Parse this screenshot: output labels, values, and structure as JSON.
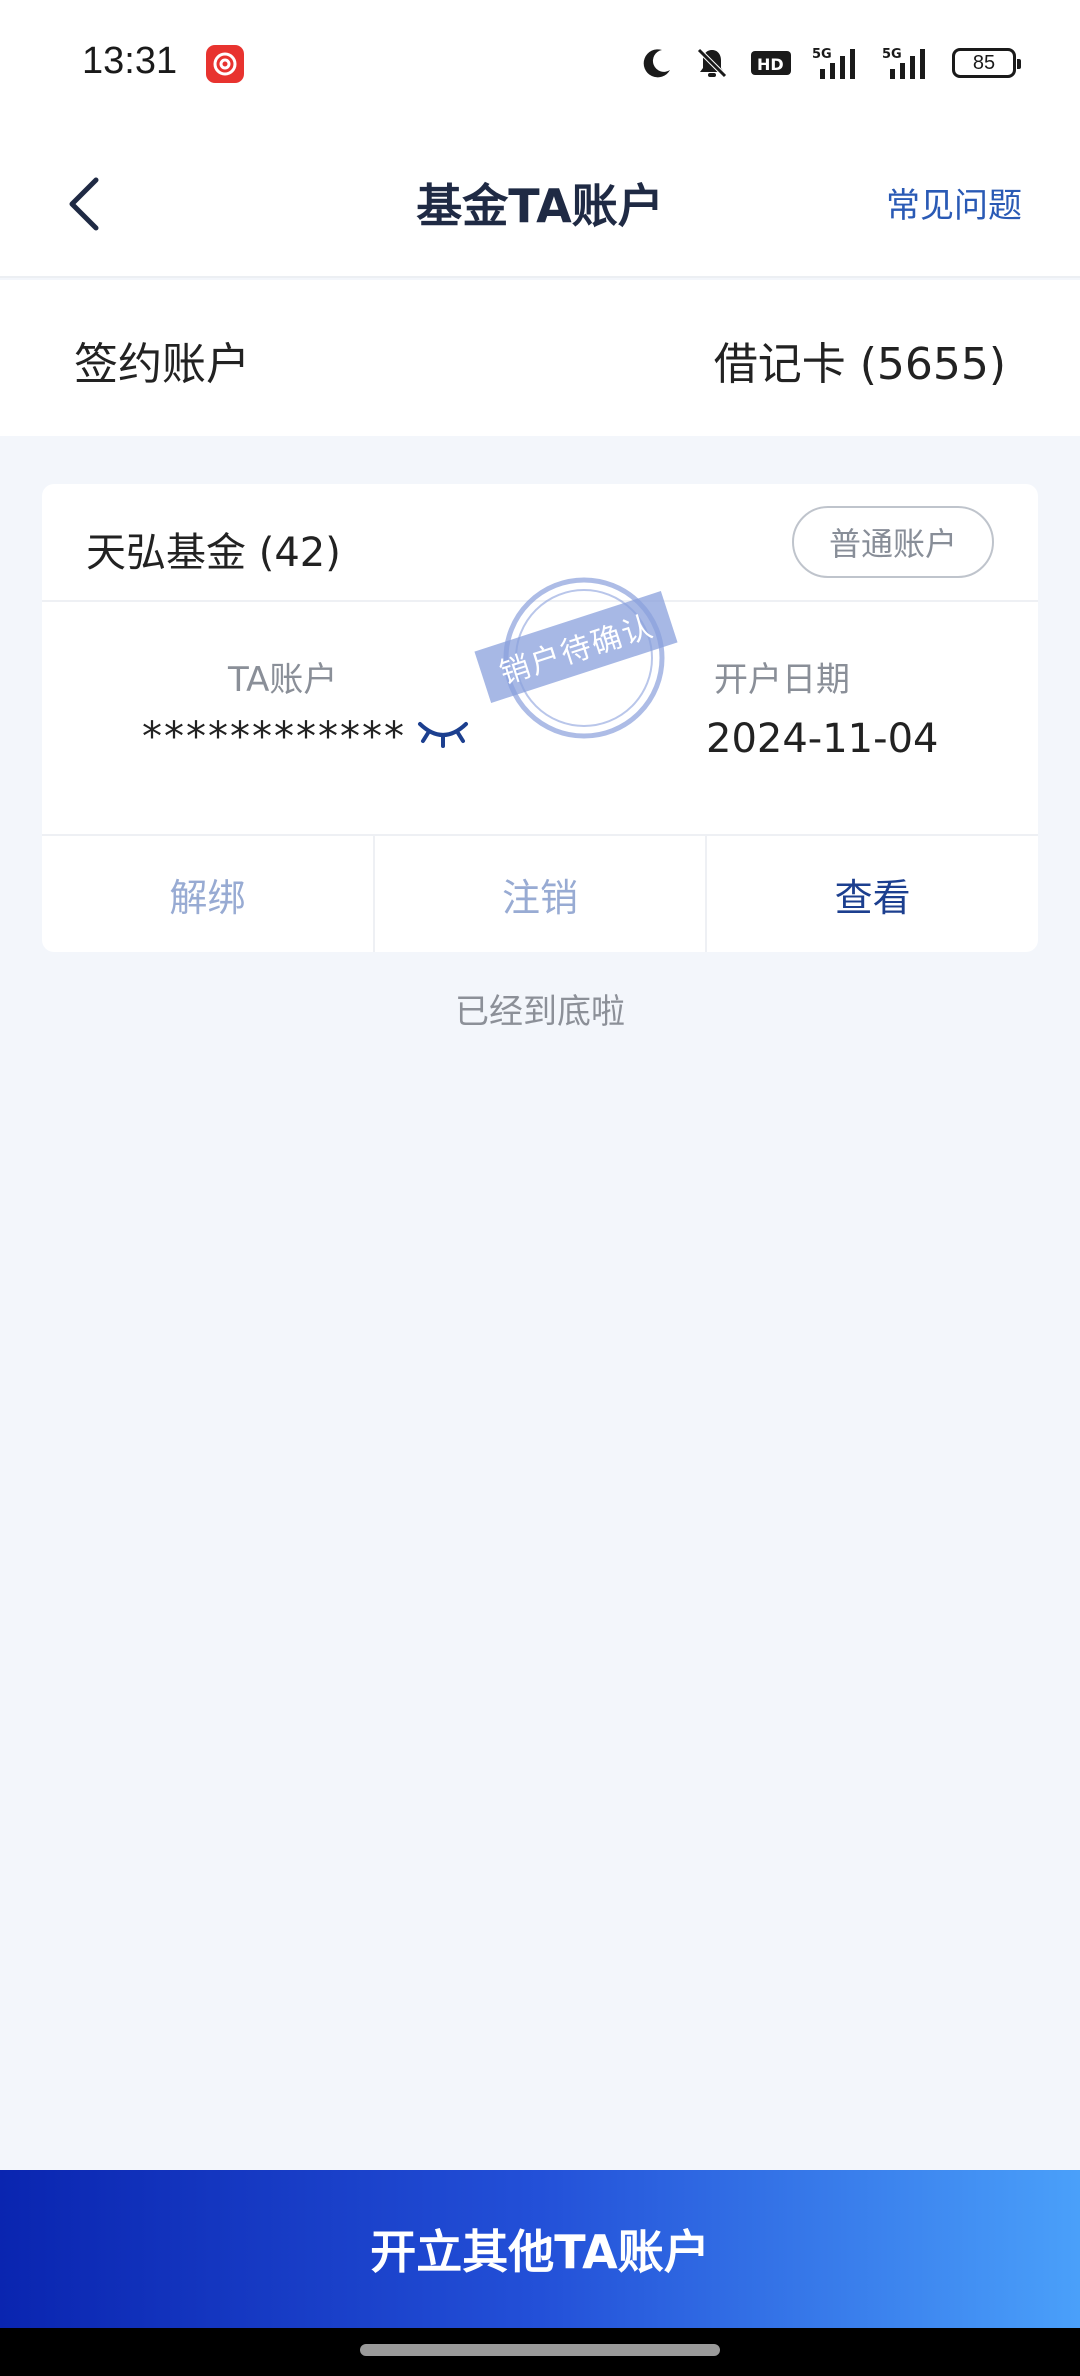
{
  "status_bar": {
    "time": "13:31",
    "battery": "85",
    "icons": [
      "netease-music-icon",
      "moon-icon",
      "bell-off-icon",
      "hd-icon",
      "signal-5g-icon",
      "signal-5g-icon",
      "battery-icon"
    ]
  },
  "nav": {
    "title": "基金TA账户",
    "faq": "常见问题"
  },
  "sign_account": {
    "label": "签约账户",
    "value": "借记卡 (5655)"
  },
  "card": {
    "fund_name": "天弘基金 (42)",
    "account_type": "普通账户",
    "stamp": "销户待确认",
    "ta_label": "TA账户",
    "ta_value": "************",
    "date_label": "开户日期",
    "date_value": "2024-11-04",
    "actions": {
      "unbind": "解绑",
      "cancel": "注销",
      "view": "查看"
    }
  },
  "end_text": "已经到底啦",
  "bottom_button": "开立其他TA账户",
  "colors": {
    "primary": "#1c3f8f",
    "link": "#2a5ab5",
    "gradient_start": "#0a25b0",
    "gradient_end": "#4aa0fa",
    "background": "#f3f6fb"
  }
}
